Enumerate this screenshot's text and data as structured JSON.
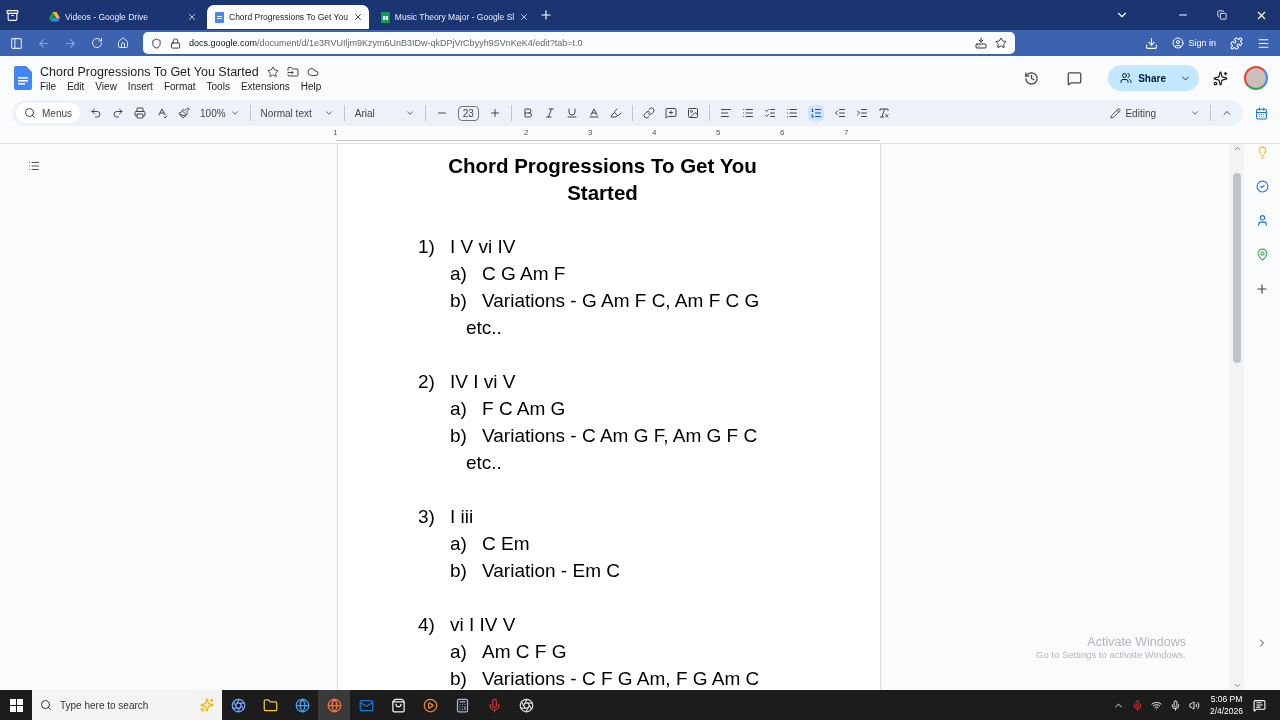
{
  "browser": {
    "tabs": [
      {
        "kind": "drive",
        "label": "Videos - Google Drive",
        "selected": false
      },
      {
        "kind": "docs",
        "label": "Chord Progressions To Get You",
        "selected": true
      },
      {
        "kind": "sheets",
        "label": "Music Theory Major - Google Sl",
        "selected": false
      }
    ],
    "url_host": "docs.google.com",
    "url_path": "/document/d/1e3RVUIljm9Kzym6UnB3IDw-qkDPjVrCbyyh9SVnKeK4/edit?tab=t.0",
    "sign_in": "Sign in"
  },
  "doc": {
    "title": "Chord Progressions To Get You Started",
    "menus": [
      "File",
      "Edit",
      "View",
      "Insert",
      "Format",
      "Tools",
      "Extensions",
      "Help"
    ],
    "share": "Share",
    "toolbar": {
      "search": "Menus",
      "zoom": "100%",
      "style": "Normal text",
      "font": "Arial",
      "size": "23",
      "mode": "Editing"
    },
    "ruler": [
      "1",
      "2",
      "3",
      "4",
      "5",
      "6",
      "7"
    ]
  },
  "page": {
    "heading": "Chord Progressions To Get You Started",
    "items": [
      {
        "marker": "1)",
        "text": "I V vi IV",
        "children": [
          {
            "marker": "a)",
            "text": "C G Am F"
          },
          {
            "marker": "b)",
            "text": "Variations - G Am F C, Am F C G etc.."
          }
        ]
      },
      {
        "marker": "2)",
        "text": "IV I vi V",
        "children": [
          {
            "marker": "a)",
            "text": "F C Am G"
          },
          {
            "marker": "b)",
            "text": "Variations - C Am G F, Am G F C etc.."
          }
        ]
      },
      {
        "marker": "3)",
        "text": "I iii",
        "children": [
          {
            "marker": "a)",
            "text": "C Em"
          },
          {
            "marker": "b)",
            "text": "Variation - Em C"
          }
        ]
      },
      {
        "marker": "4)",
        "text": "vi I IV V",
        "children": [
          {
            "marker": "a)",
            "text": "Am C F G"
          },
          {
            "marker": "b)",
            "text": "Variations - C F G Am, F G Am C"
          }
        ]
      }
    ]
  },
  "activation": {
    "title": "Activate Windows",
    "subtitle": "Go to Settings to activate Windows."
  },
  "taskbar": {
    "search_placeholder": "Type here to search",
    "time": "5:06 PM",
    "date": "2/4/2026"
  }
}
